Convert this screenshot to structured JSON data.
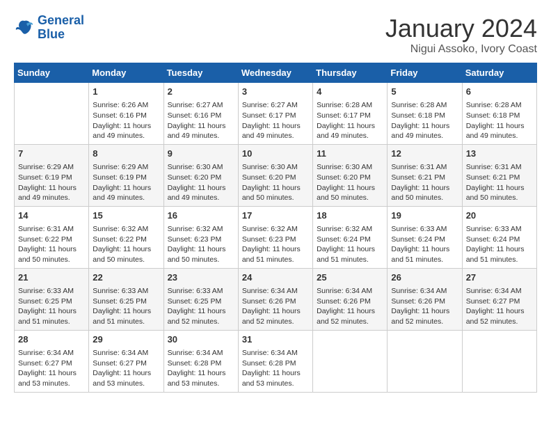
{
  "header": {
    "logo_line1": "General",
    "logo_line2": "Blue",
    "month_title": "January 2024",
    "location": "Nigui Assoko, Ivory Coast"
  },
  "days_of_week": [
    "Sunday",
    "Monday",
    "Tuesday",
    "Wednesday",
    "Thursday",
    "Friday",
    "Saturday"
  ],
  "weeks": [
    [
      {
        "day": "",
        "info": ""
      },
      {
        "day": "1",
        "info": "Sunrise: 6:26 AM\nSunset: 6:16 PM\nDaylight: 11 hours\nand 49 minutes."
      },
      {
        "day": "2",
        "info": "Sunrise: 6:27 AM\nSunset: 6:16 PM\nDaylight: 11 hours\nand 49 minutes."
      },
      {
        "day": "3",
        "info": "Sunrise: 6:27 AM\nSunset: 6:17 PM\nDaylight: 11 hours\nand 49 minutes."
      },
      {
        "day": "4",
        "info": "Sunrise: 6:28 AM\nSunset: 6:17 PM\nDaylight: 11 hours\nand 49 minutes."
      },
      {
        "day": "5",
        "info": "Sunrise: 6:28 AM\nSunset: 6:18 PM\nDaylight: 11 hours\nand 49 minutes."
      },
      {
        "day": "6",
        "info": "Sunrise: 6:28 AM\nSunset: 6:18 PM\nDaylight: 11 hours\nand 49 minutes."
      }
    ],
    [
      {
        "day": "7",
        "info": "Sunrise: 6:29 AM\nSunset: 6:19 PM\nDaylight: 11 hours\nand 49 minutes."
      },
      {
        "day": "8",
        "info": "Sunrise: 6:29 AM\nSunset: 6:19 PM\nDaylight: 11 hours\nand 49 minutes."
      },
      {
        "day": "9",
        "info": "Sunrise: 6:30 AM\nSunset: 6:20 PM\nDaylight: 11 hours\nand 49 minutes."
      },
      {
        "day": "10",
        "info": "Sunrise: 6:30 AM\nSunset: 6:20 PM\nDaylight: 11 hours\nand 50 minutes."
      },
      {
        "day": "11",
        "info": "Sunrise: 6:30 AM\nSunset: 6:20 PM\nDaylight: 11 hours\nand 50 minutes."
      },
      {
        "day": "12",
        "info": "Sunrise: 6:31 AM\nSunset: 6:21 PM\nDaylight: 11 hours\nand 50 minutes."
      },
      {
        "day": "13",
        "info": "Sunrise: 6:31 AM\nSunset: 6:21 PM\nDaylight: 11 hours\nand 50 minutes."
      }
    ],
    [
      {
        "day": "14",
        "info": "Sunrise: 6:31 AM\nSunset: 6:22 PM\nDaylight: 11 hours\nand 50 minutes."
      },
      {
        "day": "15",
        "info": "Sunrise: 6:32 AM\nSunset: 6:22 PM\nDaylight: 11 hours\nand 50 minutes."
      },
      {
        "day": "16",
        "info": "Sunrise: 6:32 AM\nSunset: 6:23 PM\nDaylight: 11 hours\nand 50 minutes."
      },
      {
        "day": "17",
        "info": "Sunrise: 6:32 AM\nSunset: 6:23 PM\nDaylight: 11 hours\nand 51 minutes."
      },
      {
        "day": "18",
        "info": "Sunrise: 6:32 AM\nSunset: 6:24 PM\nDaylight: 11 hours\nand 51 minutes."
      },
      {
        "day": "19",
        "info": "Sunrise: 6:33 AM\nSunset: 6:24 PM\nDaylight: 11 hours\nand 51 minutes."
      },
      {
        "day": "20",
        "info": "Sunrise: 6:33 AM\nSunset: 6:24 PM\nDaylight: 11 hours\nand 51 minutes."
      }
    ],
    [
      {
        "day": "21",
        "info": "Sunrise: 6:33 AM\nSunset: 6:25 PM\nDaylight: 11 hours\nand 51 minutes."
      },
      {
        "day": "22",
        "info": "Sunrise: 6:33 AM\nSunset: 6:25 PM\nDaylight: 11 hours\nand 51 minutes."
      },
      {
        "day": "23",
        "info": "Sunrise: 6:33 AM\nSunset: 6:25 PM\nDaylight: 11 hours\nand 52 minutes."
      },
      {
        "day": "24",
        "info": "Sunrise: 6:34 AM\nSunset: 6:26 PM\nDaylight: 11 hours\nand 52 minutes."
      },
      {
        "day": "25",
        "info": "Sunrise: 6:34 AM\nSunset: 6:26 PM\nDaylight: 11 hours\nand 52 minutes."
      },
      {
        "day": "26",
        "info": "Sunrise: 6:34 AM\nSunset: 6:26 PM\nDaylight: 11 hours\nand 52 minutes."
      },
      {
        "day": "27",
        "info": "Sunrise: 6:34 AM\nSunset: 6:27 PM\nDaylight: 11 hours\nand 52 minutes."
      }
    ],
    [
      {
        "day": "28",
        "info": "Sunrise: 6:34 AM\nSunset: 6:27 PM\nDaylight: 11 hours\nand 53 minutes."
      },
      {
        "day": "29",
        "info": "Sunrise: 6:34 AM\nSunset: 6:27 PM\nDaylight: 11 hours\nand 53 minutes."
      },
      {
        "day": "30",
        "info": "Sunrise: 6:34 AM\nSunset: 6:28 PM\nDaylight: 11 hours\nand 53 minutes."
      },
      {
        "day": "31",
        "info": "Sunrise: 6:34 AM\nSunset: 6:28 PM\nDaylight: 11 hours\nand 53 minutes."
      },
      {
        "day": "",
        "info": ""
      },
      {
        "day": "",
        "info": ""
      },
      {
        "day": "",
        "info": ""
      }
    ]
  ]
}
